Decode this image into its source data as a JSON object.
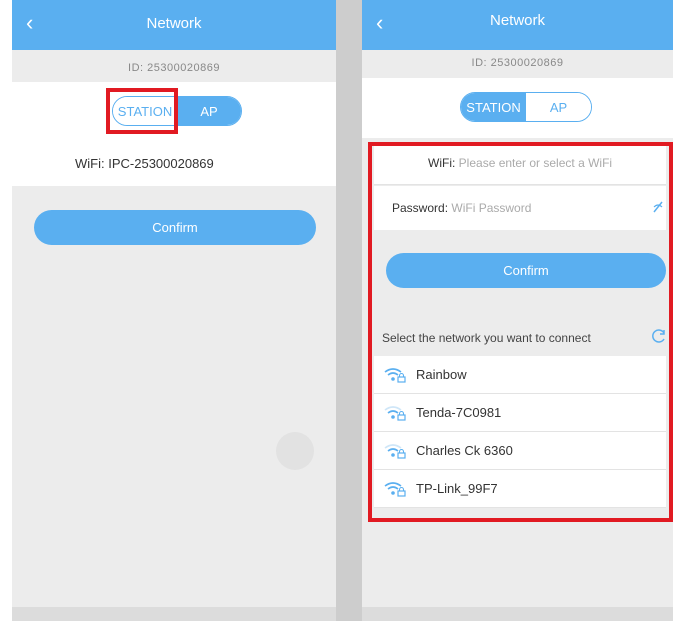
{
  "left": {
    "title": "Network",
    "back_icon": "‹",
    "device_id": "ID: 25300020869",
    "modes": [
      "STATION",
      "AP"
    ],
    "wifi_label": "WiFi:",
    "wifi_value": "IPC-25300020869",
    "confirm": "Confirm"
  },
  "right": {
    "title": "Network",
    "back_icon": "‹",
    "device_id": "ID: 25300020869",
    "modes": [
      "STATION",
      "AP"
    ],
    "wifi_label": "WiFi:",
    "wifi_placeholder": "Please enter or select a WiFi",
    "password_label": "Password:",
    "password_placeholder": "WiFi Password",
    "confirm": "Confirm",
    "select_label": "Select the network you want to connect",
    "networks": [
      "Rainbow",
      "Tenda-7C0981",
      "Charles Ck 6360",
      "TP-Link_99F7"
    ]
  },
  "colors": {
    "accent": "#5aaff0",
    "highlight": "#e11a22",
    "background": "#ececec"
  },
  "icons": {
    "back": "chevron-left-icon",
    "refresh": "refresh-icon",
    "wifi_lock": "wifi-lock-icon",
    "eye": "eye-icon"
  }
}
